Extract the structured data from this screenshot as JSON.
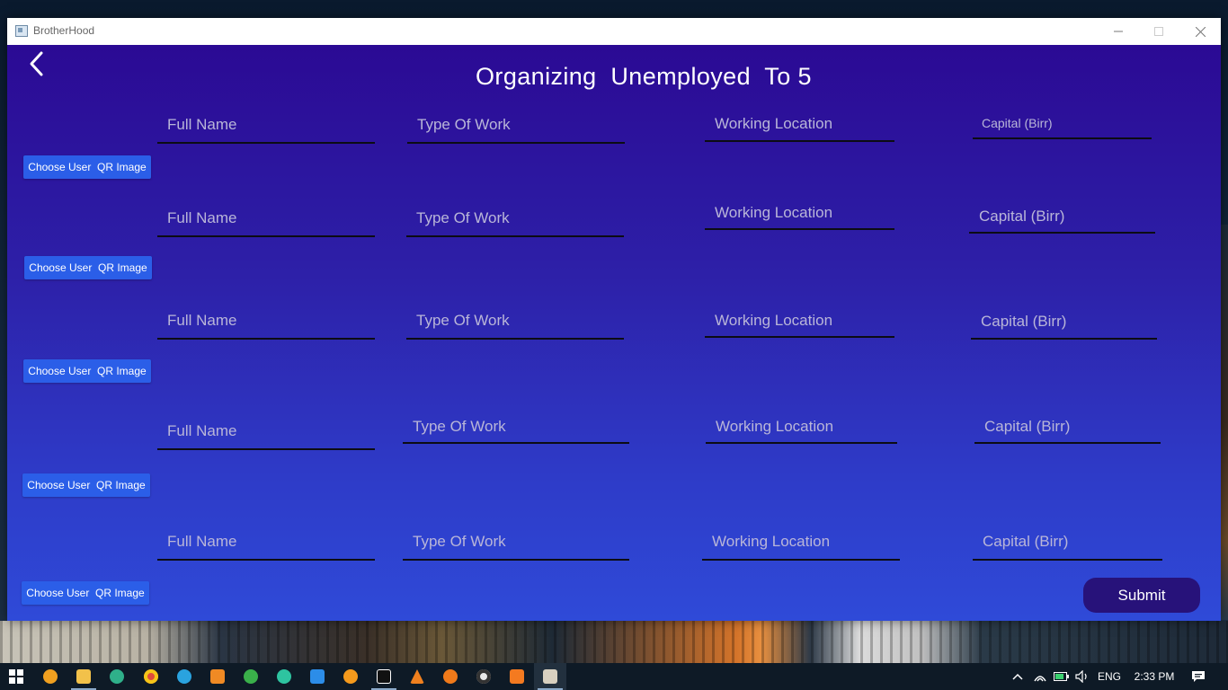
{
  "window": {
    "title": "BrotherHood"
  },
  "page": {
    "title": "Organizing  Unemployed  To 5",
    "rows": [
      {
        "full_name": "Full Name",
        "type_of_work": "Type Of Work",
        "working_location": "Working Location",
        "capital": "Capital (Birr)",
        "qr_button": "Choose User  QR Image"
      },
      {
        "full_name": "Full Name",
        "type_of_work": "Type Of Work",
        "working_location": "Working Location",
        "capital": "Capital (Birr)",
        "qr_button": "Choose User  QR Image"
      },
      {
        "full_name": "Full Name",
        "type_of_work": "Type Of Work",
        "working_location": "Working Location",
        "capital": "Capital (Birr)",
        "qr_button": "Choose User  QR Image"
      },
      {
        "full_name": "Full Name",
        "type_of_work": "Type Of Work",
        "working_location": "Working Location",
        "capital": "Capital (Birr)",
        "qr_button": "Choose User  QR Image"
      },
      {
        "full_name": "Full Name",
        "type_of_work": "Type Of Work",
        "working_location": "Working Location",
        "capital": "Capital (Birr)",
        "qr_button": "Choose User  QR Image"
      }
    ],
    "submit_label": "Submit"
  },
  "taskbar": {
    "apps": [
      "start-icon",
      "chrome-canary-icon",
      "file-explorer-icon",
      "edge-icon",
      "chrome-icon",
      "telegram-icon",
      "sublime-text-icon",
      "xampp-icon",
      "chatgpt-icon",
      "vscode-icon",
      "blender-icon",
      "intellij-icon",
      "vlc-icon",
      "search-app-icon",
      "obs-icon",
      "xampp-control-icon",
      "java-app-icon"
    ],
    "language": "ENG",
    "time": "2:33 PM"
  },
  "colors": {
    "content_top": "#2b0a94",
    "content_bottom": "#2f4ad8",
    "qr_button": "#2b5ee8",
    "submit_button": "#27127a",
    "field_underline": "#0c0c14"
  }
}
